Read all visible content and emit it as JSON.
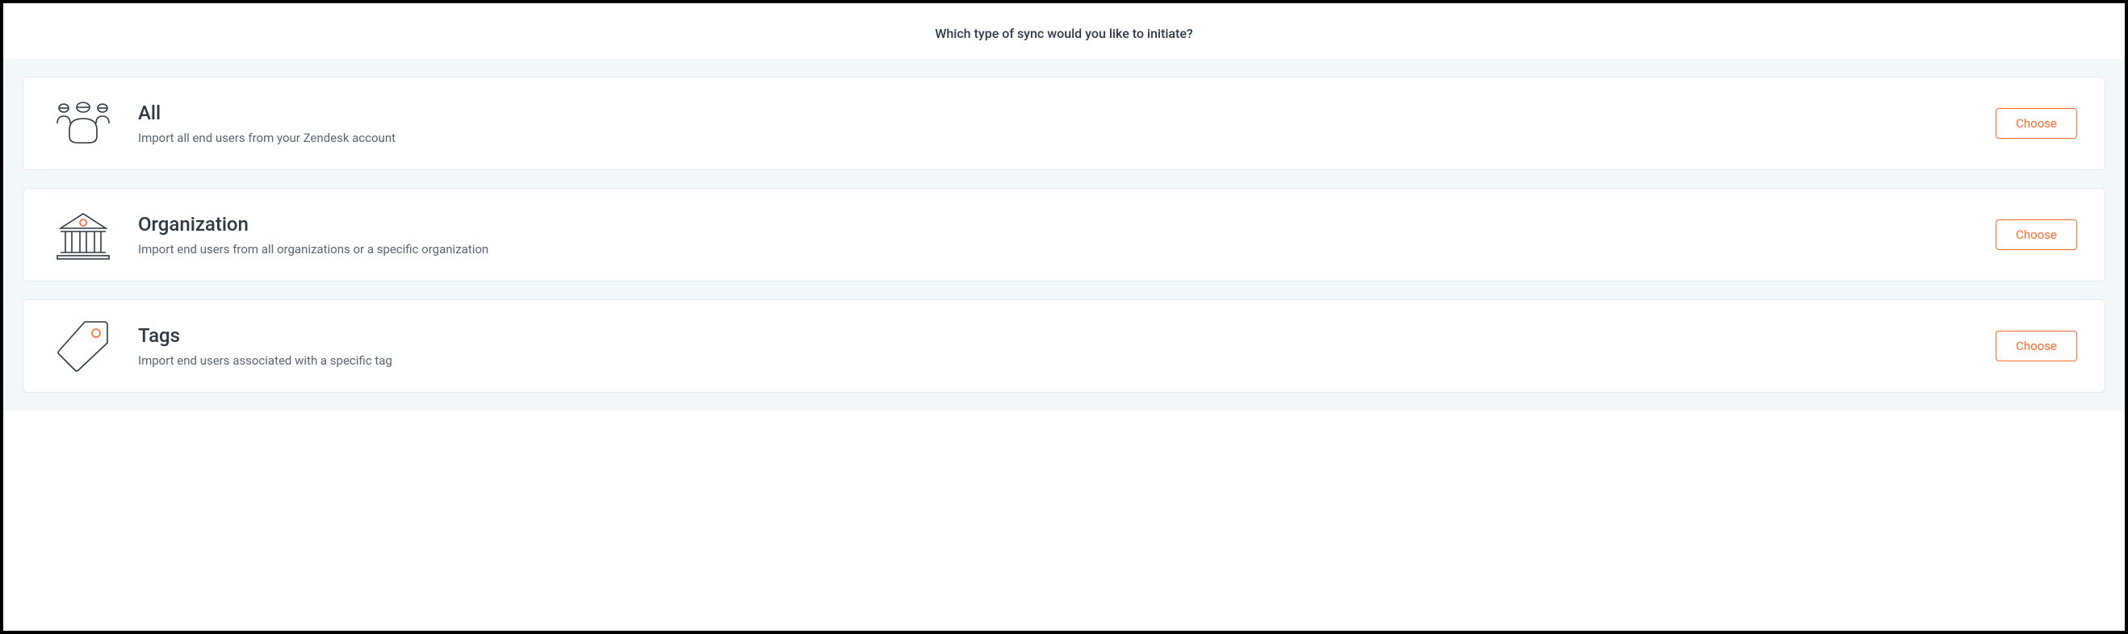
{
  "header": {
    "title": "Which type of sync would you like to initiate?"
  },
  "options": [
    {
      "title": "All",
      "description": "Import all end users from your Zendesk account",
      "button_label": "Choose"
    },
    {
      "title": "Organization",
      "description": "Import end users from all organizations or a specific organization",
      "button_label": "Choose"
    },
    {
      "title": "Tags",
      "description": "Import end users associated with a specific tag",
      "button_label": "Choose"
    }
  ]
}
